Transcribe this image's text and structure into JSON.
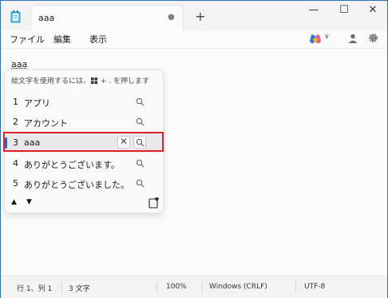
{
  "tab": {
    "title": "aaa",
    "unsaved_marker": "●"
  },
  "titlebar": {
    "new_tab": "+",
    "minimize": "—",
    "maximize": "☐",
    "close": "✕"
  },
  "menu": {
    "file": "ファイル",
    "edit": "編集",
    "view": "表示"
  },
  "editor": {
    "text": "aaa"
  },
  "ime": {
    "hint_before": "絵文字を使用するには、",
    "hint_after": " + . を押します",
    "candidates": [
      {
        "num": "1",
        "text": "アプリ"
      },
      {
        "num": "2",
        "text": "アカウント"
      },
      {
        "num": "3",
        "text": "aaa"
      },
      {
        "num": "4",
        "text": "ありがとうございます。"
      },
      {
        "num": "5",
        "text": "ありがとうございました。"
      }
    ],
    "selected_index": 2,
    "remove_glyph": "✕",
    "page_up": "▲",
    "page_down": "▼"
  },
  "status": {
    "position": "行 1、列 1",
    "count": "3 文字",
    "zoom": "100%",
    "line_ending": "Windows (CRLF)",
    "encoding": "UTF-8"
  },
  "colors": {
    "accent": "#3b5fc0",
    "highlight": "#e0202a",
    "window_border": "#2f6fb6"
  }
}
